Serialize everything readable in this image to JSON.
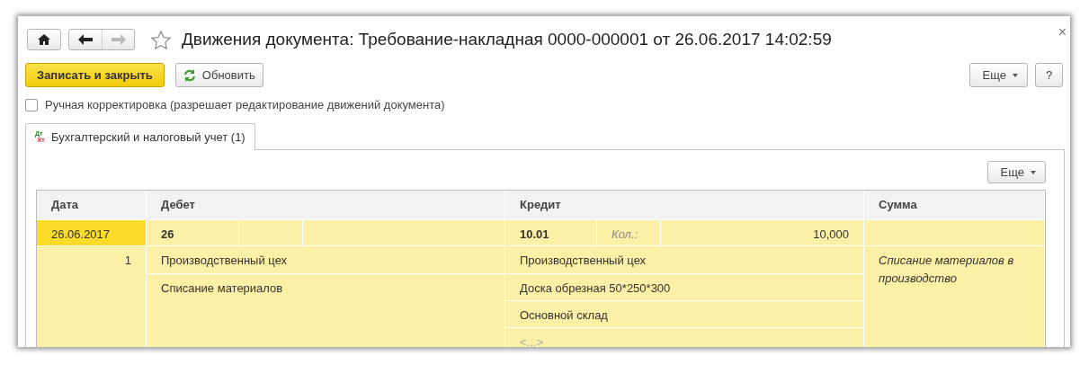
{
  "window": {
    "title": "Движения документа: Требование-накладная 0000-000001 от 26.06.2017 14:02:59",
    "close": "×"
  },
  "toolbar": {
    "save_close": "Записать и закрыть",
    "refresh": "Обновить",
    "more": "Еще",
    "help": "?"
  },
  "manual_correction": {
    "label": "Ручная корректировка (разрешает редактирование движений документа)",
    "checked": false
  },
  "tabs": [
    {
      "label": "Бухгалтерский и налоговый учет (1)",
      "icon_text": [
        "Дт",
        "Кт"
      ],
      "selected": true
    }
  ],
  "table": {
    "more": "Еще",
    "columns": [
      "Дата",
      "Дебет",
      "Кредит",
      "Сумма"
    ],
    "entries": [
      {
        "date": "26.06.2017",
        "selected": true,
        "number": "1",
        "debit": {
          "account": "26",
          "lines": [
            {
              "text": "Производственный цех",
              "kind": "value"
            },
            {
              "text": "Списание материалов",
              "kind": "value"
            }
          ]
        },
        "credit": {
          "account": "10.01",
          "qty_label": "Кол.:",
          "qty": "10,000",
          "lines": [
            {
              "text": "Производственный цех",
              "kind": "value"
            },
            {
              "text": "Доска обрезная 50*250*300",
              "kind": "value"
            },
            {
              "text": "Основной склад",
              "kind": "value"
            },
            {
              "text": "<...>",
              "kind": "empty"
            }
          ]
        },
        "content": "Списание материалов в производство"
      }
    ]
  }
}
